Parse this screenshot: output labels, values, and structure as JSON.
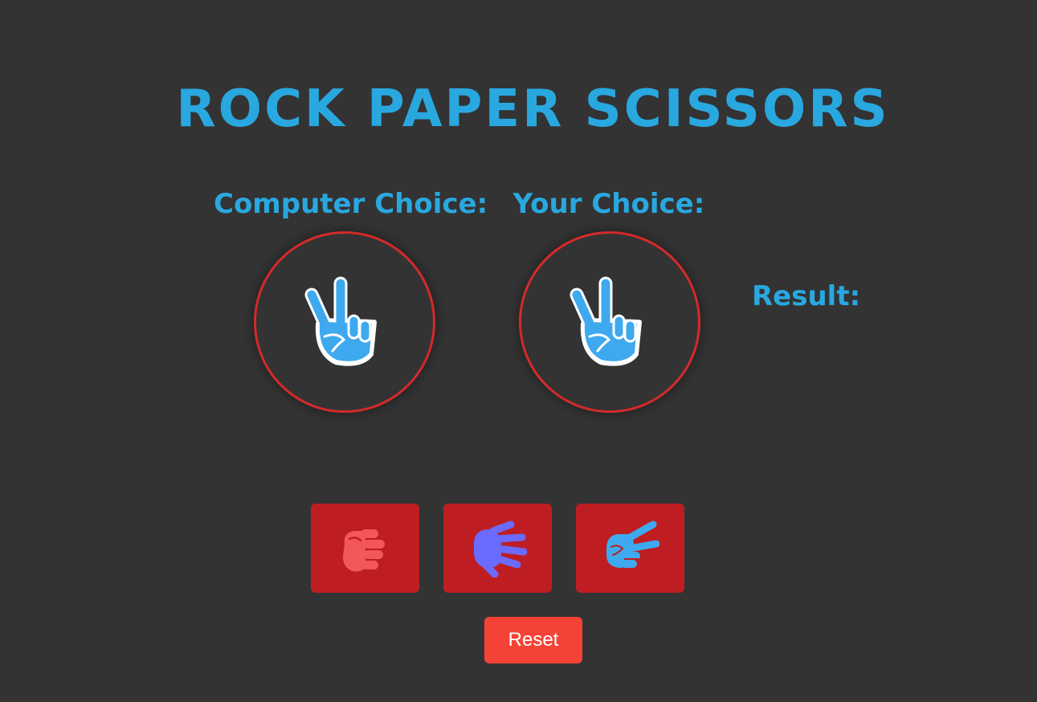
{
  "title": "ROCK PAPER SCISSORS",
  "computer": {
    "label": "Computer Choice:",
    "choice": "scissors",
    "icon": "victory-hand-icon"
  },
  "player": {
    "label": "Your Choice:",
    "choice": "scissors",
    "icon": "victory-hand-icon"
  },
  "result": {
    "label": "Result:",
    "value": ""
  },
  "moves": [
    {
      "name": "rock",
      "icon": "fist-icon",
      "color": "#f25858"
    },
    {
      "name": "paper",
      "icon": "open-hand-icon",
      "color": "#6b6bff"
    },
    {
      "name": "scissors",
      "icon": "victory-hand-icon",
      "color": "#3ea9ee"
    }
  ],
  "reset_label": "Reset",
  "colors": {
    "background": "#333333",
    "accent": "#29a8e0",
    "circle_border": "#d42a2a",
    "button": "#be1e22",
    "reset": "#f44336"
  }
}
